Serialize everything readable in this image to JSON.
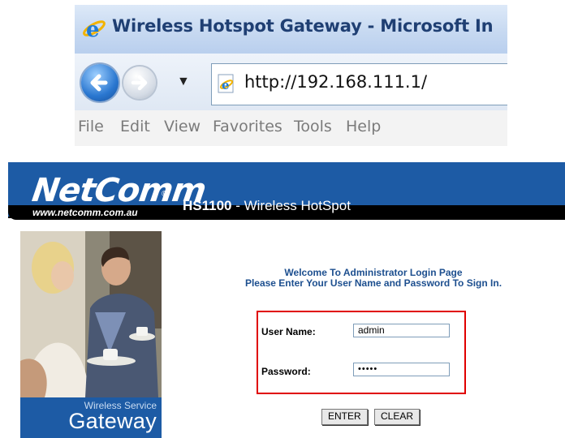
{
  "browser": {
    "window_title": "Wireless Hotspot Gateway - Microsoft In",
    "address_url": "http://192.168.111.1/",
    "menu": [
      "File",
      "Edit",
      "View",
      "Favorites",
      "Tools",
      "Help"
    ]
  },
  "router": {
    "brand": "NetComm",
    "registered": "®",
    "site_url": "www.netcomm.com.au",
    "model": "HS1100",
    "product_suffix": " - Wireless HotSpot",
    "sidebar_caption_small": "Wireless Service",
    "sidebar_caption_large": "Gateway"
  },
  "login": {
    "welcome_line1": "Welcome To Administrator Login Page",
    "welcome_line2": "Please Enter Your User Name and Password To Sign In.",
    "username_label": "User Name:",
    "username_value": "admin",
    "password_label": "Password:",
    "password_value": "•••••",
    "enter_button": "ENTER",
    "clear_button": "CLEAR"
  },
  "colors": {
    "banner_blue": "#1d5ba5",
    "highlight_red": "#e00000"
  }
}
